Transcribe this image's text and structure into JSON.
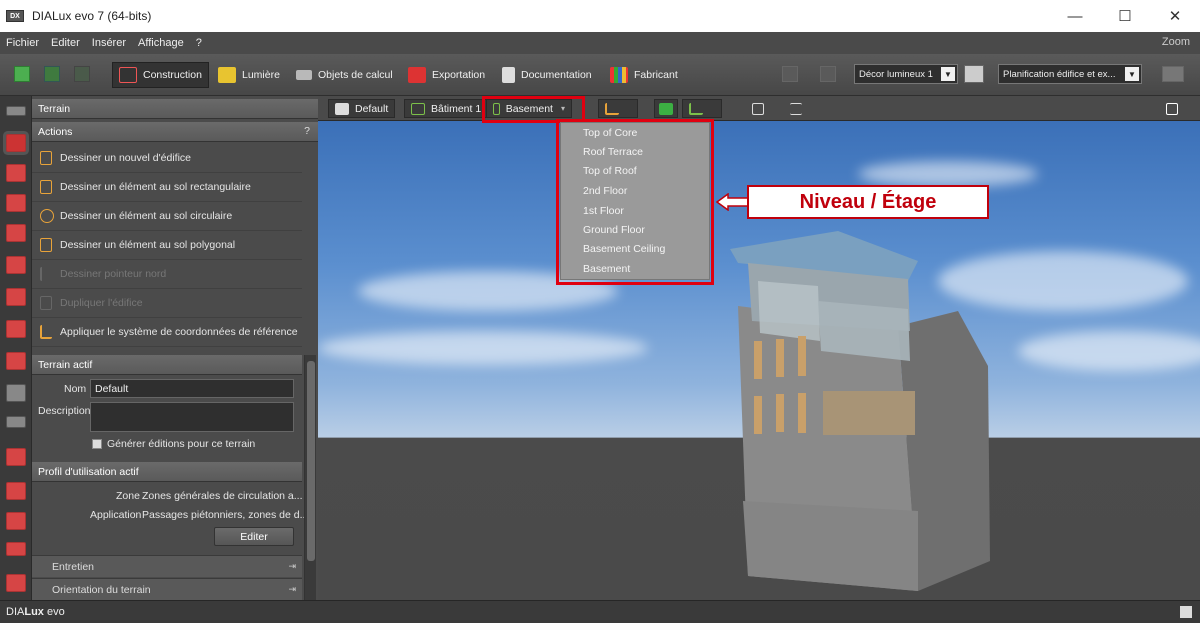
{
  "window": {
    "app_icon": "DX",
    "title": "DIALux evo 7  (64-bits)",
    "minimize": "—",
    "maximize": "☐",
    "close": "✕"
  },
  "menu": {
    "items": [
      "Fichier",
      "Editer",
      "Insérer",
      "Affichage",
      "?"
    ],
    "zoom": "Zoom"
  },
  "toolbar": {
    "tabs": [
      "Construction",
      "Lumière",
      "Objets de calcul",
      "Exportation",
      "Documentation",
      "Fabricant"
    ],
    "active_tab": "Construction",
    "decor_dropdown": "Décor lumineux 1",
    "planning_dropdown": "Planification édifice et ex..."
  },
  "panel": {
    "title": "Terrain",
    "actions_header": "Actions",
    "help": "?",
    "actions": [
      {
        "label": "Dessiner un nouvel d'édifice",
        "enabled": true
      },
      {
        "label": "Dessiner un élément au sol rectangulaire",
        "enabled": true
      },
      {
        "label": "Dessiner un élément au sol circulaire",
        "enabled": true
      },
      {
        "label": "Dessiner un élément au sol polygonal",
        "enabled": true
      },
      {
        "label": "Dessiner pointeur nord",
        "enabled": false
      },
      {
        "label": "Dupliquer l'édifice",
        "enabled": false
      },
      {
        "label": "Appliquer le système de coordonnées de référence",
        "enabled": true
      }
    ],
    "active_terrain": {
      "header": "Terrain actif",
      "name_label": "Nom",
      "name_value": "Default",
      "description_label": "Description",
      "description_value": "",
      "generate_editions_label": "Générer éditions pour ce terrain",
      "generate_editions_checked": false
    },
    "usage_profile": {
      "header": "Profil d'utilisation actif",
      "zone_label": "Zone",
      "zone_value": "Zones générales de circulation a...",
      "application_label": "Application",
      "application_value": "Passages piétonniers, zones de d...",
      "edit_button": "Editer"
    },
    "collapsed_sections": [
      "Entretien",
      "Orientation du terrain"
    ]
  },
  "viewbar": {
    "terrain": "Default",
    "building": "Bâtiment 1",
    "level": "Basement"
  },
  "levels_dropdown": [
    "Top of Core",
    "Roof Terrace",
    "Top of Roof",
    "2nd Floor",
    "1st Floor",
    "Ground Floor",
    "Basement Ceiling",
    "Basement"
  ],
  "annotation": "Niveau / Étage",
  "status": {
    "brand_dia": "DIA",
    "brand_lux": "Lux",
    "brand_evo": " evo"
  },
  "colors": {
    "highlight": "#e00010",
    "accent_red": "#d64545",
    "accent_green": "#7cc04a"
  }
}
